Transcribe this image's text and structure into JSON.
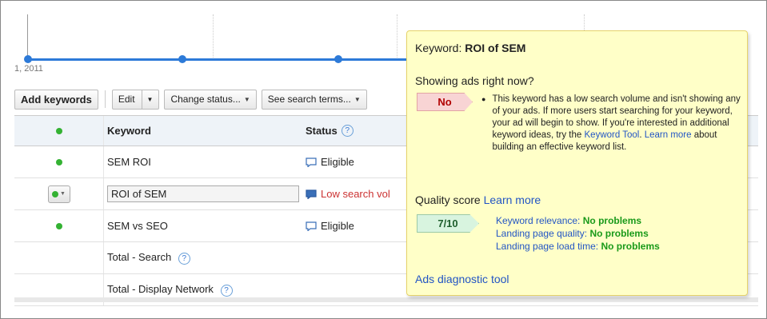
{
  "chart": {
    "date_label": "1, 2011"
  },
  "toolbar": {
    "add_keywords": "Add keywords",
    "edit": "Edit",
    "change_status": "Change status...",
    "see_search_terms": "See search terms..."
  },
  "table": {
    "headers": {
      "keyword": "Keyword",
      "status": "Status"
    },
    "rows": [
      {
        "keyword": "SEM ROI",
        "status": "Eligible",
        "status_color": "#222222"
      },
      {
        "keyword": "ROI of SEM",
        "status": "Low search vol",
        "status_color": "#cc3333"
      },
      {
        "keyword": "SEM vs SEO",
        "status": "Eligible",
        "status_color": "#222222"
      }
    ],
    "totals": [
      "Total - Search",
      "Total - Display Network"
    ]
  },
  "tooltip": {
    "keyword_label": "Keyword:",
    "keyword_value": "ROI of SEM",
    "showing_ads_question": "Showing ads right now?",
    "showing_ads_answer": "No",
    "description_1": "This keyword has a low search volume and isn't showing any of your ads. If more users start searching for your keyword, your ad will begin to show. If you're interested in additional keyword ideas, try the ",
    "keyword_tool_link": "Keyword Tool",
    "description_2": ". ",
    "learn_more_link": "Learn more",
    "description_3": " about building an effective keyword list.",
    "quality_score_label": "Quality score",
    "quality_learn_more": "Learn more",
    "quality_score_value": "7/10",
    "metrics": [
      {
        "label": "Keyword relevance:",
        "value": "No problems"
      },
      {
        "label": "Landing page quality:",
        "value": "No problems"
      },
      {
        "label": "Landing page load time:",
        "value": "No problems"
      }
    ],
    "diagnostic_link": "Ads diagnostic tool"
  },
  "colors": {
    "accent_blue": "#2d7ad8",
    "status_green": "#34b233",
    "tooltip_bg": "#ffffc8",
    "no_flag": "#f8d4d4",
    "score_flag": "#d8f4df"
  }
}
